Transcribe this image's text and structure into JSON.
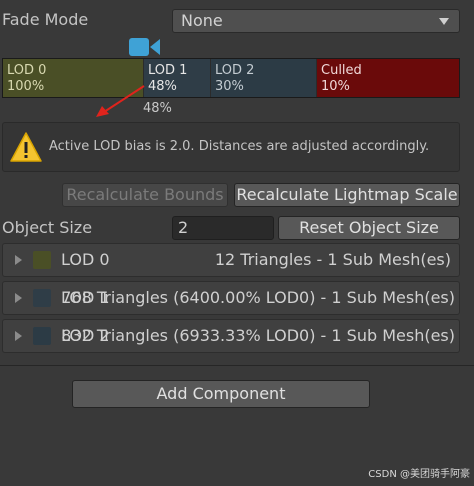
{
  "fade_mode": {
    "label": "Fade Mode",
    "value": "None"
  },
  "lod_bar": {
    "segments": [
      {
        "name": "LOD 0",
        "percent": "100%",
        "color": "#4a4f26",
        "text_color": "#d8d8b0"
      },
      {
        "name": "LOD 1",
        "percent": "48%",
        "color": "#2f3d47",
        "text_color": "#e6e6e6"
      },
      {
        "name": "LOD 2",
        "percent": "30%",
        "color": "#2c3b45",
        "text_color": "#c4ccd2"
      },
      {
        "name": "Culled",
        "percent": "10%",
        "color": "#6a0a0a",
        "text_color": "#f0d8d8"
      }
    ],
    "marker_label": "48%"
  },
  "info_box": {
    "message": "Active LOD bias is 2.0. Distances are adjusted accordingly."
  },
  "buttons": {
    "recalculate_bounds": "Recalculate Bounds",
    "recalculate_lightmap": "Recalculate Lightmap Scale",
    "reset_object_size": "Reset Object Size",
    "add_component": "Add Component"
  },
  "object_size": {
    "label": "Object Size",
    "value": "2"
  },
  "lod_rows": [
    {
      "label": "LOD 0",
      "info": "12 Triangles  - 1 Sub Mesh(es)",
      "swatch": "#4a4f26"
    },
    {
      "label": "LOD 1",
      "info": "768 Triangles (6400.00% LOD0) - 1 Sub Mesh(es)",
      "swatch": "#2f3d47"
    },
    {
      "label": "LOD 2",
      "info": "832 Triangles (6933.33% LOD0) - 1 Sub Mesh(es)",
      "swatch": "#2c3b45"
    }
  ],
  "watermark": "CSDN @美团骑手阿豪"
}
